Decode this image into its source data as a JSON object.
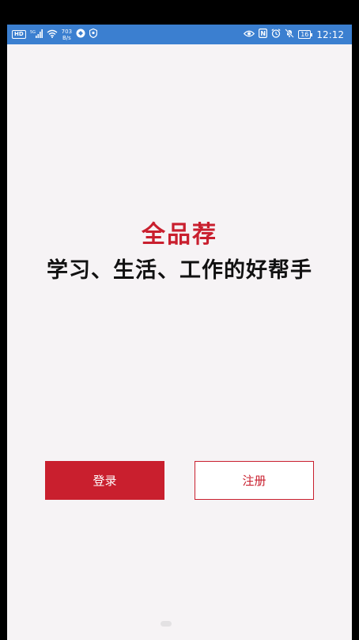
{
  "status_bar": {
    "hd_badge": "HD",
    "network_type": "5G",
    "net_speed_value": "703",
    "net_speed_unit": "B/s",
    "nfc_label": "N",
    "battery_level": "16",
    "time": "12:12",
    "background_color": "#3b7fd0"
  },
  "hero": {
    "brand": "全品荐",
    "tagline": "学习、生活、工作的好帮手"
  },
  "actions": {
    "login_label": "登录",
    "register_label": "注册"
  },
  "theme": {
    "accent": "#c91f2e",
    "page_background": "#f6f3f5",
    "outer_background": "#000000"
  }
}
